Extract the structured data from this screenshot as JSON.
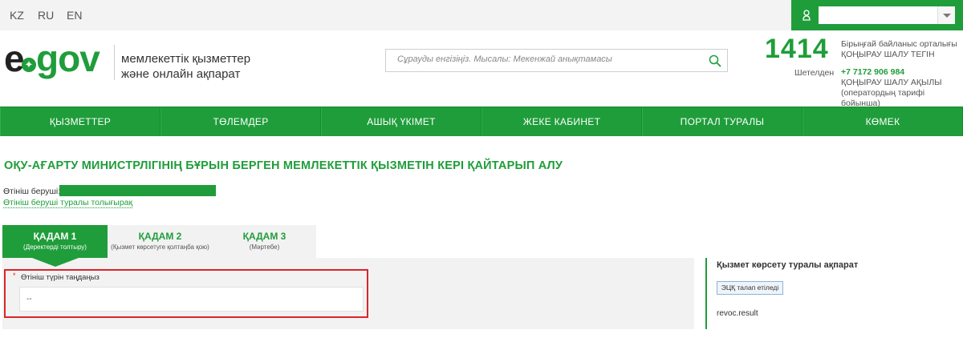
{
  "topbar": {
    "languages": [
      "KZ",
      "RU",
      "EN"
    ],
    "user_icon": "user-icon"
  },
  "header": {
    "logo": {
      "e": "e",
      "gov": "gov",
      "star": "✦"
    },
    "tagline_line1": "мемлекеттік қызметтер",
    "tagline_line2": "және онлайн ақпарат",
    "search_placeholder": "Сұрауды енгізіңіз. Мысалы: Мекенжай анықтамасы",
    "search_icon": "search-icon",
    "hotline": "1414",
    "contact_center": "Бірыңғай байланыс орталығы",
    "call_free": "ҚОҢЫРАУ ШАЛУ ТЕГІН",
    "abroad": "Шетелден",
    "phone": "+7 7172 906 984",
    "call_paid": "ҚОҢЫРАУ ШАЛУ АҚЫЛЫ",
    "operator_tariff": "(оператордың тарифі бойынша)"
  },
  "nav": {
    "items": [
      "ҚЫЗМЕТТЕР",
      "ТӨЛЕМДЕР",
      "АШЫҚ ҮКІМЕТ",
      "ЖЕКЕ КАБИНЕТ",
      "ПОРТАЛ ТУРАЛЫ",
      "КӨМЕК"
    ]
  },
  "page": {
    "title": "ОҚУ-АҒАРТУ МИНИСТРЛІГІНІҢ БҰРЫН БЕРГЕН МЕМЛЕКЕТТІК ҚЫЗМЕТІН КЕРІ ҚАЙТАРЫП АЛУ",
    "applicant_label": "Өтініш беруші:",
    "applicant_link": "Өтініш беруші туралы толығырақ"
  },
  "steps": [
    {
      "title": "ҚАДАМ 1",
      "subtitle": "(Деректерді толтыру)",
      "active": true
    },
    {
      "title": "ҚАДАМ 2",
      "subtitle": "(Қызмет көрсетуге қолтаңба қою)",
      "active": false
    },
    {
      "title": "ҚАДАМ 3",
      "subtitle": "(Мәртебе)",
      "active": false
    }
  ],
  "form": {
    "required_mark": "*",
    "field_label": "Өтініш түрін таңдаңыз",
    "select_value": "--"
  },
  "info": {
    "title": "Қызмет көрсету туралы ақпарат",
    "eds_button": "ЭЦҚ талап етіледі",
    "result": "revoc.result"
  },
  "colors": {
    "brand_green": "#1f9d3a",
    "highlight_red": "#d9252b"
  }
}
